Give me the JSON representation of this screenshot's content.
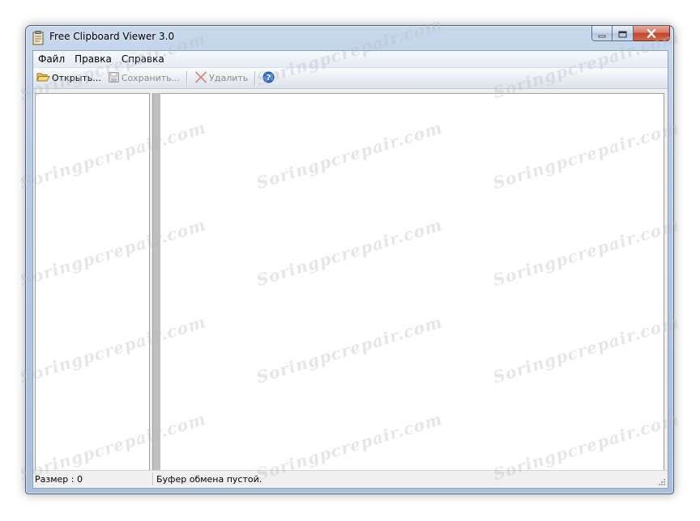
{
  "window": {
    "title": "Free Clipboard Viewer 3.0"
  },
  "menu": {
    "items": [
      "Файл",
      "Правка",
      "Справка"
    ]
  },
  "toolbar": {
    "open_label": "Открыть...",
    "save_label": "Сохранить...",
    "delete_label": "Удалить"
  },
  "status": {
    "size": "Размер : 0",
    "message": "Буфер обмена пустой."
  },
  "watermark": {
    "text": "Soringpcrepair.com"
  },
  "colors": {
    "title_bar": "#b9cde5",
    "close_button": "#c1452c",
    "pane_background": "#ffffff",
    "splitter": "#bfbfbf"
  }
}
